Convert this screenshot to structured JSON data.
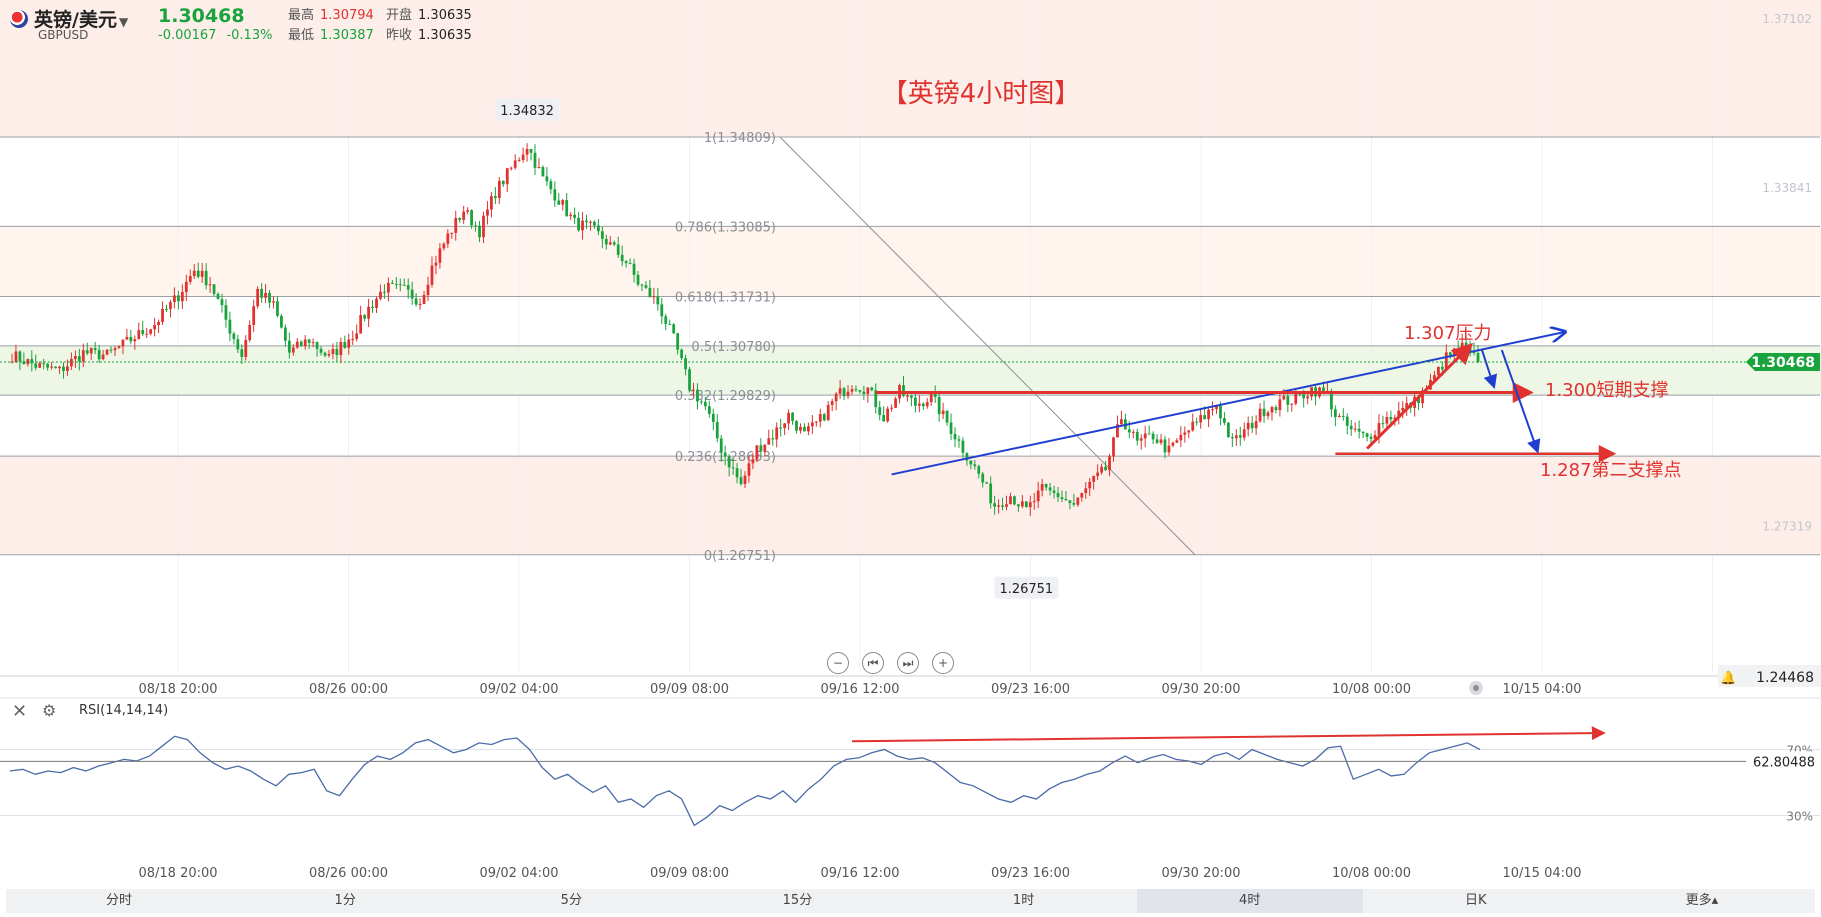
{
  "header": {
    "symbol_name": "英镑/美元",
    "symbol_code": "GBPUSD",
    "last_price": "1.30468",
    "change": "-0.00167",
    "change_pct": "-0.13%",
    "high_label": "最高",
    "high": "1.30794",
    "low_label": "最低",
    "low": "1.30387",
    "open_label": "开盘",
    "open": "1.30635",
    "prev_close_label": "昨收",
    "prev_close": "1.30635"
  },
  "colors": {
    "up": "#e0322f",
    "down": "#19a33d",
    "trend": "#1f3fd0",
    "rsi": "#4a6aa8"
  },
  "tabs": [
    {
      "label": "分时"
    },
    {
      "label": "1分"
    },
    {
      "label": "5分"
    },
    {
      "label": "15分"
    },
    {
      "label": "1时"
    },
    {
      "label": "4时",
      "active": true
    },
    {
      "label": "日K"
    },
    {
      "label": "更多▴"
    }
  ],
  "controls": [
    "zoom-out-icon",
    "skip-back-icon",
    "skip-forward-icon",
    "zoom-in-icon"
  ],
  "chart_data": {
    "type": "candlestick",
    "title": "【英镑4小时图】",
    "xlabel": "",
    "ylabel": "",
    "ylim": [
      1.2449,
      1.372
    ],
    "price_ticks": [
      "1.37102",
      "1.33841",
      "1.27319",
      "1.24468"
    ],
    "current_price_label": "1.30468",
    "x_ticks": [
      "08/18 20:00",
      "08/26 00:00",
      "09/02 04:00",
      "09/09 08:00",
      "09/16 12:00",
      "09/23 16:00",
      "09/30 20:00",
      "10/08 00:00",
      "10/15 04:00"
    ],
    "high_marker": {
      "label": "1.34832",
      "value": 1.34832
    },
    "low_marker": {
      "label": "1.26751",
      "value": 1.26751
    },
    "fib_levels": [
      {
        "label": "1(1.34809)",
        "value": 1.34809
      },
      {
        "label": "0.786(1.33085)",
        "value": 1.33085
      },
      {
        "label": "0.618(1.31731)",
        "value": 1.31731
      },
      {
        "label": "0.5(1.30780)",
        "value": 1.3078
      },
      {
        "label": "0.382(1.29829)",
        "value": 1.29829
      },
      {
        "label": "0.236(1.28653)",
        "value": 1.28653
      },
      {
        "label": "0(1.26751)",
        "value": 1.26751
      }
    ],
    "annotations": [
      {
        "text": "1.307压力",
        "color": "#e0322f"
      },
      {
        "text": "1.300短期支撑",
        "color": "#e0322f"
      },
      {
        "text": "1.287第二支撑点",
        "color": "#e0322f"
      }
    ],
    "path": [
      [
        0,
        1.306
      ],
      [
        6,
        1.304
      ],
      [
        12,
        1.303
      ],
      [
        18,
        1.3065
      ],
      [
        24,
        1.306
      ],
      [
        30,
        1.309
      ],
      [
        36,
        1.312
      ],
      [
        42,
        1.3175
      ],
      [
        46,
        1.3225
      ],
      [
        50,
        1.32
      ],
      [
        55,
        1.311
      ],
      [
        58,
        1.306
      ],
      [
        62,
        1.3185
      ],
      [
        66,
        1.3155
      ],
      [
        70,
        1.3065
      ],
      [
        75,
        1.309
      ],
      [
        80,
        1.3055
      ],
      [
        86,
        1.31
      ],
      [
        90,
        1.315
      ],
      [
        94,
        1.319
      ],
      [
        99,
        1.3185
      ],
      [
        103,
        1.3165
      ],
      [
        106,
        1.323
      ],
      [
        110,
        1.329
      ],
      [
        114,
        1.334
      ],
      [
        118,
        1.33
      ],
      [
        122,
        1.3375
      ],
      [
        126,
        1.342
      ],
      [
        130,
        1.3465
      ],
      [
        134,
        1.34
      ],
      [
        138,
        1.336
      ],
      [
        142,
        1.3315
      ],
      [
        146,
        1.3305
      ],
      [
        150,
        1.328
      ],
      [
        155,
        1.324
      ],
      [
        158,
        1.32
      ],
      [
        163,
        1.316
      ],
      [
        167,
        1.309
      ],
      [
        171,
        1.3
      ],
      [
        175,
        1.296
      ],
      [
        179,
        1.288
      ],
      [
        184,
        1.281
      ],
      [
        188,
        1.288
      ],
      [
        192,
        1.2905
      ],
      [
        196,
        1.2945
      ],
      [
        200,
        1.2905
      ],
      [
        204,
        1.2935
      ],
      [
        208,
        1.298
      ],
      [
        212,
        1.3005
      ],
      [
        216,
        1.2995
      ],
      [
        220,
        1.294
      ],
      [
        224,
        1.299
      ],
      [
        228,
        1.2965
      ],
      [
        232,
        1.298
      ],
      [
        236,
        1.293
      ],
      [
        240,
        1.288
      ],
      [
        244,
        1.283
      ],
      [
        248,
        1.277
      ],
      [
        252,
        1.279
      ],
      [
        256,
        1.276
      ],
      [
        260,
        1.28
      ],
      [
        264,
        1.279
      ],
      [
        268,
        1.277
      ],
      [
        272,
        1.281
      ],
      [
        276,
        1.284
      ],
      [
        280,
        1.294
      ],
      [
        284,
        1.289
      ],
      [
        288,
        1.2905
      ],
      [
        292,
        1.2875
      ],
      [
        296,
        1.291
      ],
      [
        300,
        1.2935
      ],
      [
        304,
        1.2965
      ],
      [
        308,
        1.289
      ],
      [
        312,
        1.292
      ],
      [
        316,
        1.2955
      ],
      [
        320,
        1.297
      ],
      [
        324,
        1.2975
      ],
      [
        328,
        1.2995
      ],
      [
        332,
        1.2985
      ],
      [
        334,
        1.2945
      ],
      [
        338,
        1.2915
      ],
      [
        342,
        1.29
      ],
      [
        346,
        1.2935
      ],
      [
        350,
        1.295
      ],
      [
        354,
        1.297
      ],
      [
        358,
        1.3005
      ],
      [
        362,
        1.3055
      ],
      [
        366,
        1.3075
      ],
      [
        370,
        1.3047
      ]
    ],
    "rsi": {
      "name": "RSI(14,14,14)",
      "level_labels": [
        "70%",
        "30%"
      ],
      "current_label": "62.80488",
      "values": [
        57,
        58,
        55,
        57,
        56,
        59,
        57,
        60,
        62,
        64,
        63,
        66,
        72,
        78,
        76,
        68,
        62,
        58,
        60,
        57,
        52,
        48,
        55,
        56,
        58,
        45,
        42,
        52,
        61,
        66,
        64,
        68,
        74,
        76,
        72,
        68,
        70,
        74,
        73,
        76,
        77,
        70,
        59,
        52,
        55,
        49,
        44,
        48,
        38,
        40,
        35,
        42,
        45,
        40,
        24,
        29,
        36,
        33,
        38,
        42,
        40,
        45,
        38,
        46,
        52,
        60,
        64,
        65,
        68,
        70,
        66,
        64,
        65,
        62,
        56,
        50,
        48,
        44,
        40,
        38,
        42,
        40,
        46,
        50,
        52,
        55,
        57,
        62,
        66,
        62,
        65,
        67,
        64,
        63,
        61,
        66,
        68,
        64,
        70,
        67,
        64,
        62,
        60,
        64,
        71,
        72,
        52,
        55,
        58,
        54,
        55,
        62,
        68,
        70,
        72,
        74,
        70
      ]
    }
  }
}
